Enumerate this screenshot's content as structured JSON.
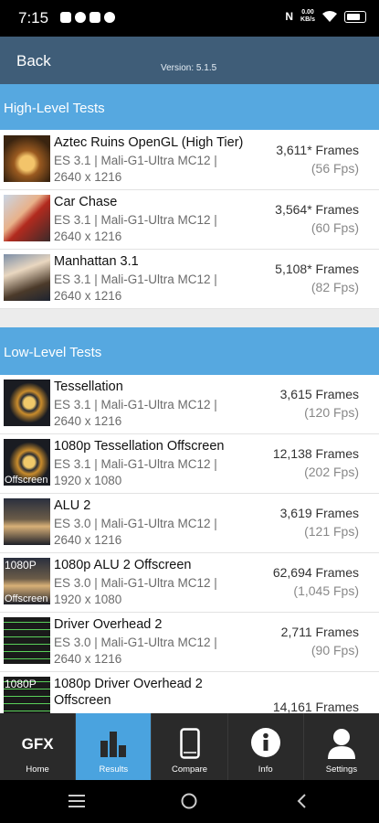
{
  "status": {
    "time": "7:15",
    "speed_value": "0.00",
    "speed_unit": "KB/s"
  },
  "header": {
    "back_label": "Back",
    "version": "Version: 5.1.5"
  },
  "sections": [
    {
      "title": "High-Level Tests",
      "items": [
        {
          "name": "Aztec Ruins OpenGL (High Tier)",
          "line1": "ES 3.1 | Mali-G1-Ultra MC12 |",
          "line2": "2640 x 1216",
          "score": "3,611* Frames",
          "fps": "(56 Fps)",
          "thumb": "aztec"
        },
        {
          "name": "Car Chase",
          "line1": "ES 3.1 | Mali-G1-Ultra MC12 |",
          "line2": "2640 x 1216",
          "score": "3,564* Frames",
          "fps": "(60 Fps)",
          "thumb": "car"
        },
        {
          "name": "Manhattan 3.1",
          "line1": "ES 3.1 | Mali-G1-Ultra MC12 |",
          "line2": "2640 x 1216",
          "score": "5,108* Frames",
          "fps": "(82 Fps)",
          "thumb": "manhattan"
        }
      ]
    },
    {
      "title": "Low-Level Tests",
      "items": [
        {
          "name": "Tessellation",
          "line1": "ES 3.1 | Mali-G1-Ultra MC12 |",
          "line2": "2640 x 1216",
          "score": "3,615 Frames",
          "fps": "(120 Fps)",
          "thumb": "tess"
        },
        {
          "name": "1080p Tessellation Offscreen",
          "line1": "ES 3.1 | Mali-G1-Ultra MC12 |",
          "line2": "1920 x 1080",
          "score": "12,138 Frames",
          "fps": "(202 Fps)",
          "thumb": "tess",
          "thumb_tag": "Offscreen"
        },
        {
          "name": "ALU 2",
          "line1": "ES 3.0 | Mali-G1-Ultra MC12 |",
          "line2": "2640 x 1216",
          "score": "3,619 Frames",
          "fps": "(121 Fps)",
          "thumb": "alu"
        },
        {
          "name": "1080p ALU 2 Offscreen",
          "line1": "ES 3.0 | Mali-G1-Ultra MC12 |",
          "line2": "1920 x 1080",
          "score": "62,694 Frames",
          "fps": "(1,045 Fps)",
          "thumb": "alu",
          "thumb_tag_top": "1080P",
          "thumb_tag": "Offscreen"
        },
        {
          "name": "Driver Overhead 2",
          "line1": "ES 3.0 | Mali-G1-Ultra MC12 |",
          "line2": "2640 x 1216",
          "score": "2,711 Frames",
          "fps": "(90 Fps)",
          "thumb": "driver"
        },
        {
          "name": "1080p Driver Overhead 2",
          "line1": "Offscreen",
          "line2": "",
          "score": "14,161 Frames",
          "fps": "",
          "thumb": "driver",
          "thumb_tag_top": "1080P"
        }
      ]
    }
  ],
  "tabs": [
    {
      "label": "Home",
      "icon": "gfx-logo-icon",
      "icon_text": "GFX",
      "active": false
    },
    {
      "label": "Results",
      "icon": "bar-chart-icon",
      "active": true
    },
    {
      "label": "Compare",
      "icon": "phone-icon",
      "active": false
    },
    {
      "label": "Info",
      "icon": "info-icon",
      "active": false
    },
    {
      "label": "Settings",
      "icon": "user-icon",
      "active": false
    }
  ],
  "colors": {
    "topbar": "#3f5d78",
    "section": "#56a8e0",
    "tab_active": "#4aa3df"
  }
}
